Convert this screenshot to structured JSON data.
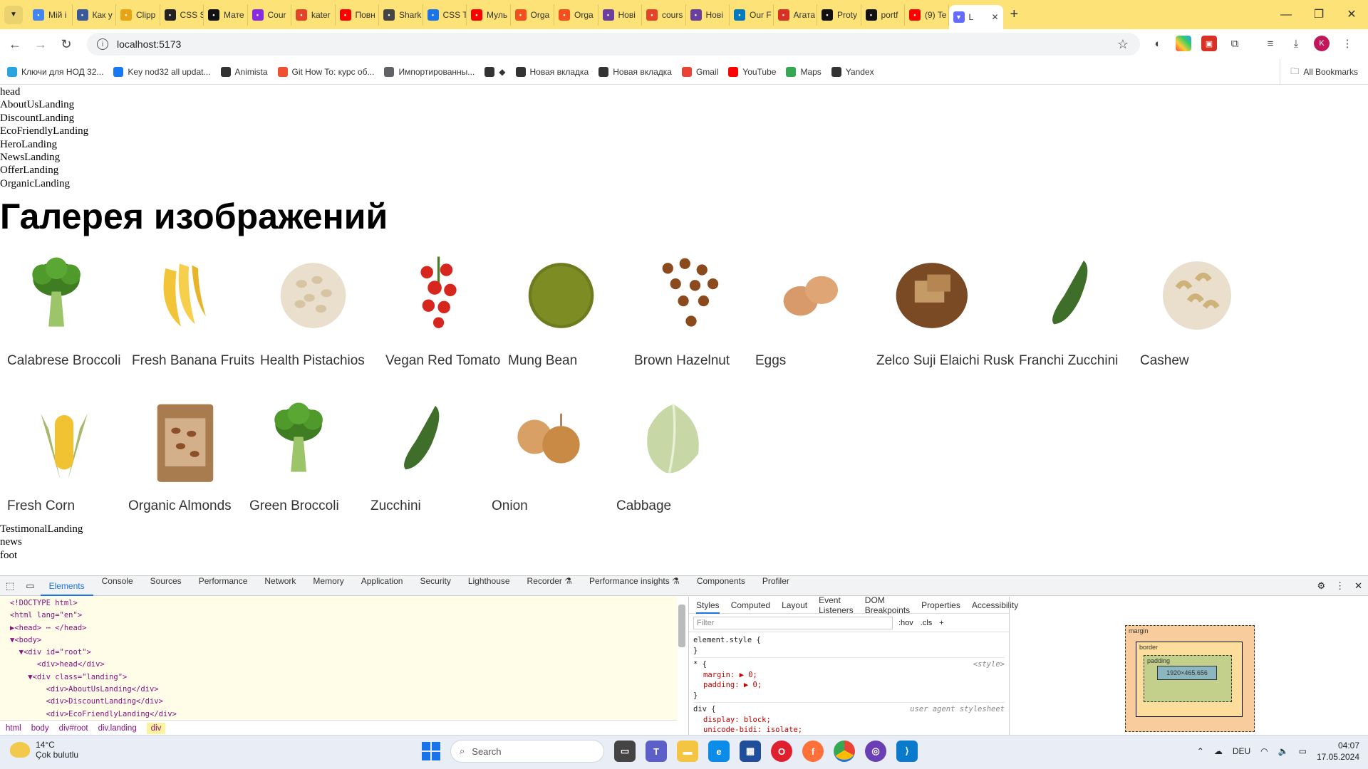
{
  "tabs": [
    {
      "label": "Мій і",
      "icon": "apps-icon",
      "color": "#4285f4"
    },
    {
      "label": "Как у",
      "icon": "wp-icon",
      "color": "#3a5998"
    },
    {
      "label": "Clipp",
      "icon": "clipper-icon",
      "color": "#e8a317"
    },
    {
      "label": "CSS S",
      "icon": "css-icon",
      "color": "#222222"
    },
    {
      "label": "Мате",
      "icon": "k-icon",
      "color": "#111111"
    },
    {
      "label": "Cour",
      "icon": "course-icon",
      "color": "#8a2be2"
    },
    {
      "label": "kater",
      "icon": "gitlab-icon",
      "color": "#e24329"
    },
    {
      "label": "Повн",
      "icon": "youtube-icon",
      "color": "#ff0000"
    },
    {
      "label": "Shark",
      "icon": "chatgpt-icon",
      "color": "#444444"
    },
    {
      "label": "CSS T",
      "icon": "stack-icon",
      "color": "#1a73e8"
    },
    {
      "label": "Муль",
      "icon": "youtube-icon",
      "color": "#ff0000"
    },
    {
      "label": "Orga",
      "icon": "figma-icon",
      "color": "#f24e1e"
    },
    {
      "label": "Orga",
      "icon": "figma-icon",
      "color": "#f24e1e"
    },
    {
      "label": "Нові",
      "icon": "ext-icon",
      "color": "#6b3fa0"
    },
    {
      "label": "cours",
      "icon": "gitlab-icon",
      "color": "#e24329"
    },
    {
      "label": "Нові",
      "icon": "ext-icon",
      "color": "#6b3fa0"
    },
    {
      "label": "Our F",
      "icon": "trello-icon",
      "color": "#0079bf"
    },
    {
      "label": "Агата",
      "icon": "frame-icon",
      "color": "#d93025"
    },
    {
      "label": "Proty",
      "icon": "github-icon",
      "color": "#111111"
    },
    {
      "label": "portf",
      "icon": "github-icon",
      "color": "#111111"
    },
    {
      "label": "(9) Te",
      "icon": "youtube-icon",
      "color": "#ff0000"
    }
  ],
  "active_tab": {
    "label": "L",
    "icon": "vite-icon",
    "color": "#646cff"
  },
  "address": {
    "url": "localhost:5173"
  },
  "bookmarks": [
    {
      "label": "Ключи для НОД 32...",
      "icon": "telegram-icon",
      "color": "#2aa3df"
    },
    {
      "label": "Key nod32 all updat...",
      "icon": "facebook-icon",
      "color": "#1877f2"
    },
    {
      "label": "Animista",
      "icon": "animista-icon",
      "color": "#333333"
    },
    {
      "label": "Git How To: курс об...",
      "icon": "git-icon",
      "color": "#f05032"
    },
    {
      "label": "Импортированны...",
      "icon": "folder-icon",
      "color": "#5f6368"
    },
    {
      "label": "◆",
      "icon": "globe-icon",
      "color": "#333333"
    },
    {
      "label": "Новая вкладка",
      "icon": "globe-icon",
      "color": "#333333"
    },
    {
      "label": "Новая вкладка",
      "icon": "history-icon",
      "color": "#333333"
    },
    {
      "label": "Gmail",
      "icon": "gmail-icon",
      "color": "#ea4335"
    },
    {
      "label": "YouTube",
      "icon": "youtube-icon",
      "color": "#ff0000"
    },
    {
      "label": "Maps",
      "icon": "maps-icon",
      "color": "#34a853"
    },
    {
      "label": "Yandex",
      "icon": "globe-icon",
      "color": "#333333"
    }
  ],
  "all_bookmarks": "All Bookmarks",
  "page": {
    "top_lines": [
      "head",
      "AboutUsLanding",
      "DiscountLanding",
      "EcoFriendlyLanding",
      "HeroLanding",
      "NewsLanding",
      "OfferLanding",
      "OrganicLanding"
    ],
    "title": "Галерея изображений",
    "gallery_row1": [
      {
        "name": "Calabrese Broccoli",
        "icon": "broccoli-icon"
      },
      {
        "name": "Fresh Banana Fruits",
        "icon": "banana-icon"
      },
      {
        "name": "Health Pistachios",
        "icon": "pistachio-icon"
      },
      {
        "name": "Vegan Red Tomato",
        "icon": "tomato-icon"
      },
      {
        "name": "Mung Bean",
        "icon": "mung-bean-icon"
      },
      {
        "name": "Brown Hazelnut",
        "icon": "hazelnut-icon"
      },
      {
        "name": "Eggs",
        "icon": "eggs-icon"
      },
      {
        "name": "Zelco Suji Elaichi Rusk",
        "icon": "rusk-icon"
      },
      {
        "name": "Franchi Zucchini",
        "icon": "zucchini-icon"
      },
      {
        "name": "Cashew",
        "icon": "cashew-icon"
      }
    ],
    "gallery_row2": [
      {
        "name": "Fresh Corn",
        "icon": "corn-icon"
      },
      {
        "name": "Organic Almonds",
        "icon": "almonds-icon"
      },
      {
        "name": "Green Broccoli",
        "icon": "broccoli-icon"
      },
      {
        "name": "Zucchini",
        "icon": "zucchini-icon"
      },
      {
        "name": "Onion",
        "icon": "onion-icon"
      },
      {
        "name": "Cabbage",
        "icon": "cabbage-icon"
      }
    ],
    "bottom_lines": [
      "TestimonalLanding",
      "news",
      "foot"
    ]
  },
  "devtools": {
    "tabs": [
      "Elements",
      "Console",
      "Sources",
      "Performance",
      "Network",
      "Memory",
      "Application",
      "Security",
      "Lighthouse",
      "Recorder ⚗",
      "Performance insights ⚗",
      "Components",
      "Profiler"
    ],
    "dom_lines": [
      "<!DOCTYPE html>",
      "<html lang=\"en\">",
      "▶<head> ⋯ </head>",
      "▼<body>",
      "  ▼<div id=\"root\">",
      "      <div>head</div>",
      "    ▼<div class=\"landing\">",
      "        <div>AboutUsLanding</div>",
      "        <div>DiscountLanding</div>",
      "        <div>EcoFriendlyLanding</div>"
    ],
    "breadcrumbs": [
      "html",
      "body",
      "div#root",
      "div.landing",
      "div"
    ],
    "style_tabs": [
      "Styles",
      "Computed",
      "Layout",
      "Event Listeners",
      "DOM Breakpoints",
      "Properties",
      "Accessibility"
    ],
    "filter_placeholder": "Filter",
    "filter_tools": [
      ":hov",
      ".cls",
      "+"
    ],
    "rules": [
      {
        "selector": "element.style {",
        "props": [],
        "source": ""
      },
      {
        "selector": "* {",
        "props": [
          "margin: ▶ 0;",
          "padding: ▶ 0;"
        ],
        "source": "<style>"
      },
      {
        "selector": "div {",
        "props": [
          "display: block;",
          "unicode-bidi: isolate;"
        ],
        "source": "user agent stylesheet"
      }
    ],
    "box_model": {
      "margin": "margin",
      "border": "border",
      "padding": "padding",
      "content": "1920×465.656",
      "dash": "–"
    }
  },
  "taskbar": {
    "temp": "14°C",
    "weather": "Çok bulutlu",
    "search": "Search",
    "lang": "DEU",
    "time": "04:07",
    "date": "17.05.2024"
  }
}
